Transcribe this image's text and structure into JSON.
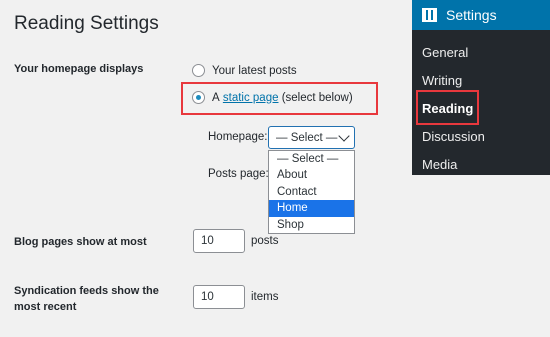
{
  "page": {
    "title": "Reading Settings"
  },
  "homepage_displays": {
    "label": "Your homepage displays",
    "option_latest": "Your latest posts",
    "option_static_prefix": "A",
    "option_static_link": "static page",
    "option_static_suffix": "(select below)",
    "selected": "static page"
  },
  "homepage_select": {
    "label": "Homepage:",
    "current_value": "— Select —",
    "options": [
      "— Select —",
      "About",
      "Contact",
      "Home",
      "Shop"
    ],
    "highlighted": "Home"
  },
  "posts_page": {
    "label": "Posts page:"
  },
  "blog_pages": {
    "label": "Blog pages show at most",
    "value": "10",
    "unit": "posts"
  },
  "syndication": {
    "label_line1": "Syndication feeds show the",
    "label_line2": "most recent",
    "value": "10",
    "unit": "items"
  },
  "admin_menu": {
    "heading": "Settings",
    "items": [
      "General",
      "Writing",
      "Reading",
      "Discussion",
      "Media"
    ],
    "current": "Reading",
    "accent": "#0073aa",
    "background": "#23282d"
  },
  "colors": {
    "highlight_border": "#e8383d",
    "link": "#0073aa",
    "selected_option": "#1a73e8"
  }
}
